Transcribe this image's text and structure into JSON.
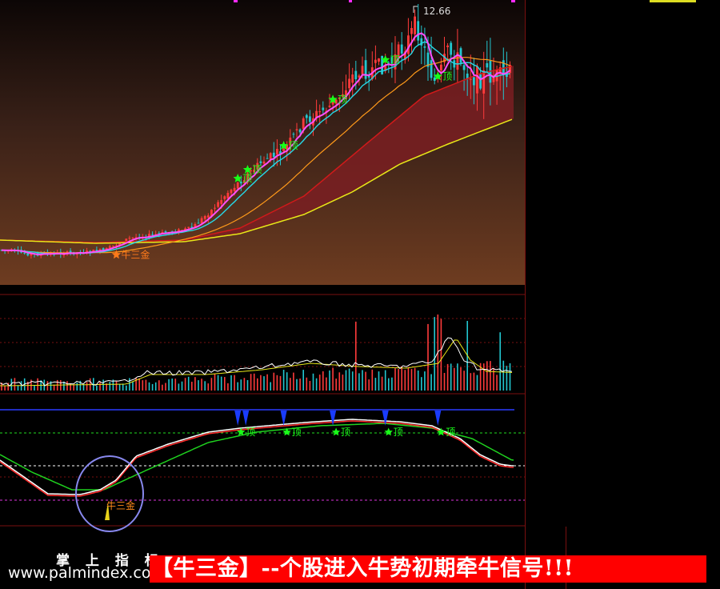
{
  "colors": {
    "candle_up": "#ff3b3b",
    "candle_down": "#22c7d0",
    "ma_fast": "#ff4fff",
    "ma_mid": "#26d9e8",
    "ma_slow": "#ff9a1a",
    "ribbon": "#7a1f22",
    "ma_long": "#e8e818",
    "signal_star": "#19ff19",
    "start_star": "#ff7a1a",
    "osc_white": "#ffffff",
    "osc_red": "#ff2b2b",
    "osc_green": "#1fd11f",
    "arrow": "#1a3cff",
    "circle": "#8888ee"
  },
  "labels": {
    "max_price": "12.66",
    "top_marker": "顶",
    "start_signal": "牛三金"
  },
  "chart_data": [
    {
      "panel": "price",
      "type": "candlestick",
      "max_price_label": 12.66,
      "signals": [
        {
          "bar": 34,
          "type": "buy",
          "label": "牛三金"
        },
        {
          "bar": 72,
          "type": "top",
          "label": "顶"
        },
        {
          "bar": 75,
          "type": "top",
          "label": "顶"
        },
        {
          "bar": 86,
          "type": "top",
          "label": "顶"
        },
        {
          "bar": 101,
          "type": "top",
          "label": "顶"
        },
        {
          "bar": 117,
          "type": "top",
          "label": "顶"
        },
        {
          "bar": 133,
          "type": "top",
          "label": "顶"
        }
      ]
    },
    {
      "panel": "volume",
      "type": "bar",
      "series": [
        {
          "values": [
            30,
            45,
            38,
            52,
            60,
            48,
            55,
            65,
            70,
            58,
            62,
            75,
            80,
            68,
            72,
            95,
            110,
            88,
            102,
            130,
            160,
            145,
            120,
            135,
            175,
            150,
            140,
            185,
            220,
            170,
            190,
            240,
            200,
            180,
            260,
            310,
            230,
            210,
            190,
            170,
            160,
            150
          ]
        }
      ]
    },
    {
      "panel": "oscillator",
      "type": "line",
      "signals": [
        {
          "bar": 72,
          "type": "top",
          "label": "顶"
        },
        {
          "bar": 86,
          "type": "top",
          "label": "顶"
        },
        {
          "bar": 101,
          "type": "top",
          "label": "顶"
        },
        {
          "bar": 117,
          "type": "top",
          "label": "顶"
        },
        {
          "bar": 133,
          "type": "top",
          "label": "顶"
        },
        {
          "bar": 34,
          "type": "buy",
          "label": "牛三金"
        }
      ]
    }
  ],
  "footer": {
    "brand": "掌 上 指 标",
    "site": "www.palmindex.com",
    "banner": "【牛三金】--个股进入牛势初期牵牛信号!!!"
  }
}
